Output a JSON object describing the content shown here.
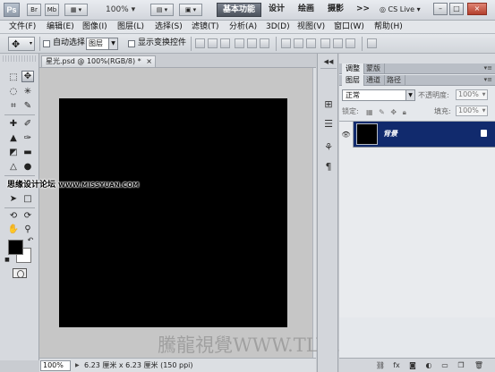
{
  "appbar": {
    "logo": "Ps",
    "bridge": "Br",
    "minibridge": "Mb",
    "zoom": "100%",
    "workspaces": [
      "基本功能",
      "设计",
      "绘画",
      "摄影",
      ">>"
    ],
    "cslive": "CS Live"
  },
  "menu": [
    "文件(F)",
    "编辑(E)",
    "图像(I)",
    "图层(L)",
    "选择(S)",
    "滤镜(T)",
    "分析(A)",
    "3D(D)",
    "视图(V)",
    "窗口(W)",
    "帮助(H)"
  ],
  "options": {
    "auto_select": "自动选择:",
    "auto_select_value": "图层",
    "show_transform": "显示变换控件"
  },
  "document": {
    "tab_title": "星光.psd @ 100%(RGB/8) *",
    "close": "×",
    "zoom": "100%",
    "status": "6.23 厘米 x 6.23 厘米 (150 ppi)"
  },
  "watermark": {
    "text": "思缘设计论坛",
    "url": "WWW.MISSYUAN.COM",
    "brand": "騰龍視覺WWW.TLVI.NET"
  },
  "panels": {
    "top_tabs": [
      "调整",
      "蒙版"
    ],
    "layer_tabs": [
      "图层",
      "通道",
      "路径"
    ],
    "blend_mode": "正常",
    "opacity_label": "不透明度:",
    "opacity_value": "100%",
    "lock_label": "锁定:",
    "fill_label": "填充:",
    "fill_value": "100%",
    "layers": [
      {
        "name": "背景",
        "visible": true,
        "locked": true
      }
    ]
  },
  "colors": {
    "accent": "#112a6d",
    "canvas": "#000000",
    "workspace": "#c6c6c6"
  }
}
